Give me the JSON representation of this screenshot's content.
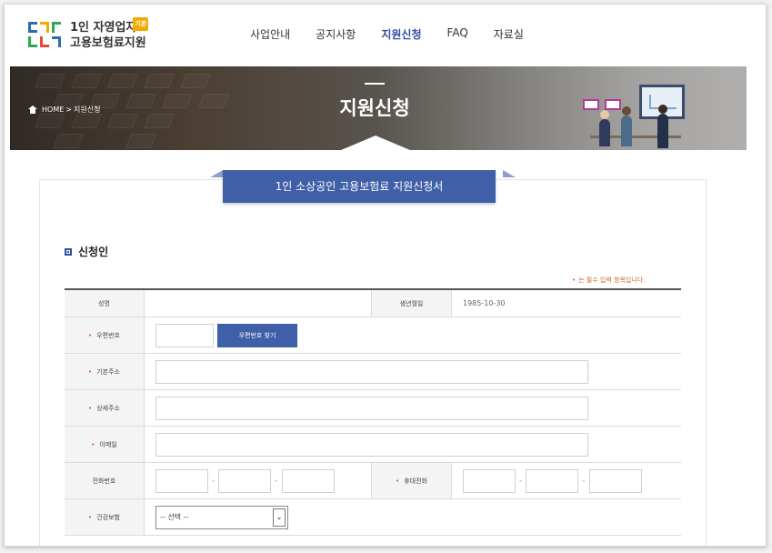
{
  "header": {
    "logo_line1": "1인 자영업자",
    "logo_line2": "고용보험료지원",
    "logo_badge": "기본",
    "nav": [
      "사업안내",
      "공지사항",
      "지원신청",
      "FAQ",
      "자료실"
    ],
    "active_nav": "지원신청"
  },
  "banner": {
    "breadcrumb_home": "HOME",
    "breadcrumb_sep": ">",
    "breadcrumb_current": "지원신청",
    "title": "지원신청"
  },
  "form": {
    "title": "1인 소상공인 고용보험료 지원신청서",
    "section_title": "신청인",
    "required_note": "는 필수 입력 항목입니다.",
    "required_mark": "•",
    "fields": {
      "name_label": "성명",
      "name_value": "",
      "birth_label": "생년월일",
      "birth_value": "1985-10-30",
      "zip_label": "우편번호",
      "zip_value": "",
      "zip_button": "우편번호 찾기",
      "addr1_label": "기본주소",
      "addr1_value": "",
      "addr2_label": "상세주소",
      "addr2_value": "",
      "email_label": "이메일",
      "email_value": "",
      "phone_label": "전화번호",
      "phone_sep": "-",
      "mobile_label": "휴대전화",
      "mobile_part2": "",
      "mobile_part3": "",
      "insurance_label": "건강보험",
      "insurance_selected": "-- 선택 --"
    }
  },
  "colors": {
    "brand_blue": "#3f5fa8",
    "required_red": "#e14b4b",
    "note_orange": "#c76b2b"
  },
  "icons": {
    "home": "home-icon",
    "section": "square-bullet-icon",
    "select": "chevron-down-icon"
  }
}
